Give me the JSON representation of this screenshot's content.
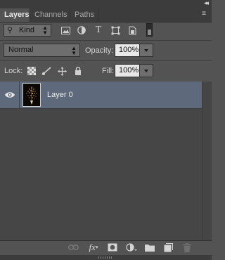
{
  "tabs": [
    {
      "label": "Layers",
      "active": true
    },
    {
      "label": "Channels",
      "active": false
    },
    {
      "label": "Paths",
      "active": false
    }
  ],
  "filter": {
    "kind_label": "Kind",
    "icons": [
      "image-filter-icon",
      "adjustment-filter-icon",
      "type-filter-icon",
      "shape-filter-icon",
      "smart-object-filter-icon"
    ]
  },
  "blend": {
    "mode": "Normal",
    "opacity_label": "Opacity:",
    "opacity_value": "100%"
  },
  "lock": {
    "label": "Lock:",
    "fill_label": "Fill:",
    "fill_value": "100%"
  },
  "layers": [
    {
      "name": "Layer 0",
      "visible": true,
      "selected": true
    }
  ],
  "colors": {
    "panel_bg": "#535353",
    "selected_row": "#5e6a7c",
    "list_bg": "#464646"
  }
}
